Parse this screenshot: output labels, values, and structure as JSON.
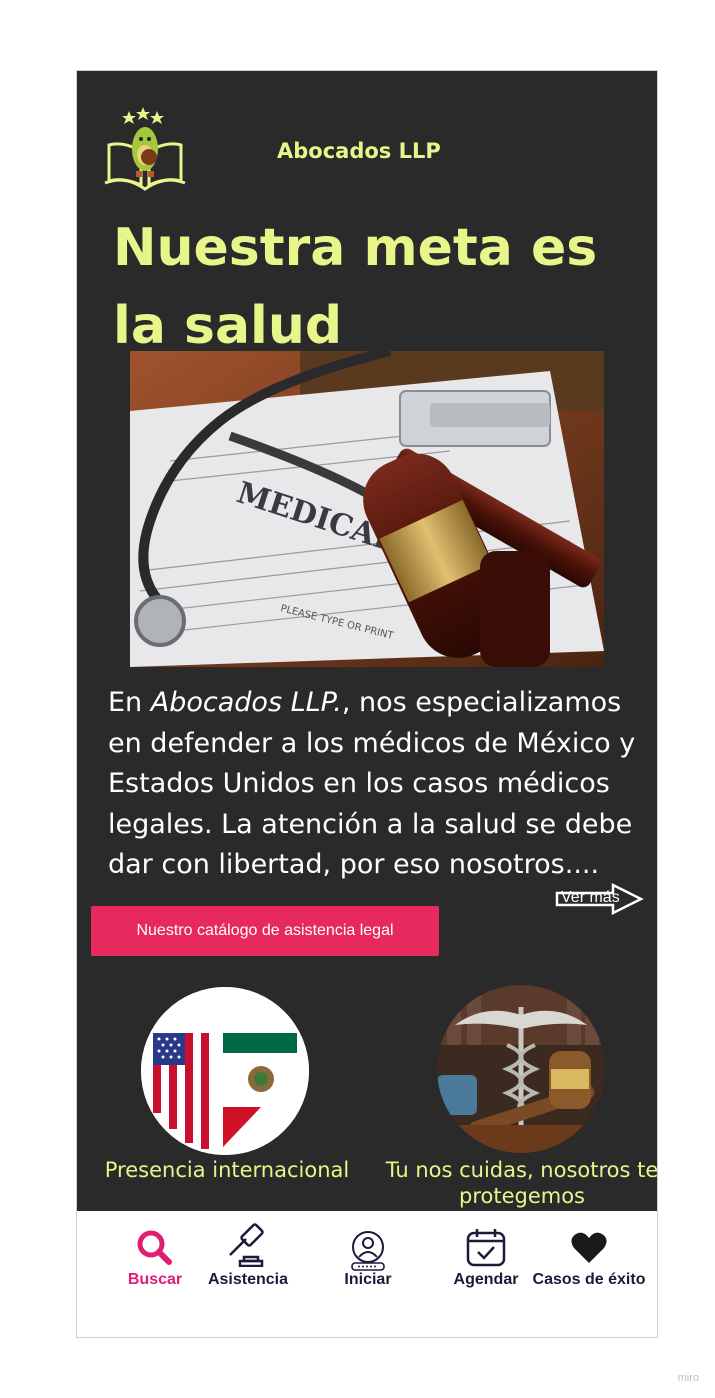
{
  "header": {
    "brand": "Abocados LLP"
  },
  "hero": {
    "headline": "Nuestra meta es la salud"
  },
  "intro": {
    "pre": "En ",
    "brand_italic": "Abocados LLP.",
    "post": ", nos especializamos en defender a los médicos de México y Estados Unidos en los casos médicos legales. La atención a la salud se debe dar con libertad, por eso nosotros....",
    "more_label": "Ver más"
  },
  "cta": {
    "catalog_label": "Nuestro catálogo de asistencia legal"
  },
  "features": [
    {
      "caption": "Presencia internacional",
      "icon": "us-mexico-flag-icon"
    },
    {
      "caption": "Tu nos cuidas, nosotros te protegemos",
      "icon": "caduceus-gavel-icon"
    }
  ],
  "nav": {
    "items": [
      {
        "label": "Buscar",
        "icon": "search-icon",
        "active": true
      },
      {
        "label": "Asistencia",
        "icon": "gavel-icon",
        "active": false
      },
      {
        "label": "Iniciar",
        "icon": "user-login-icon",
        "active": false
      },
      {
        "label": "Agendar",
        "icon": "calendar-check-icon",
        "active": false
      },
      {
        "label": "Casos de éxito",
        "icon": "heart-icon",
        "active": false
      }
    ],
    "active_color": "#e01e73",
    "text_color": "#1a1a3a"
  },
  "colors": {
    "accent": "#e7f58a",
    "background": "#2a2a2a",
    "button": "#e8295f"
  },
  "watermark": "miro"
}
